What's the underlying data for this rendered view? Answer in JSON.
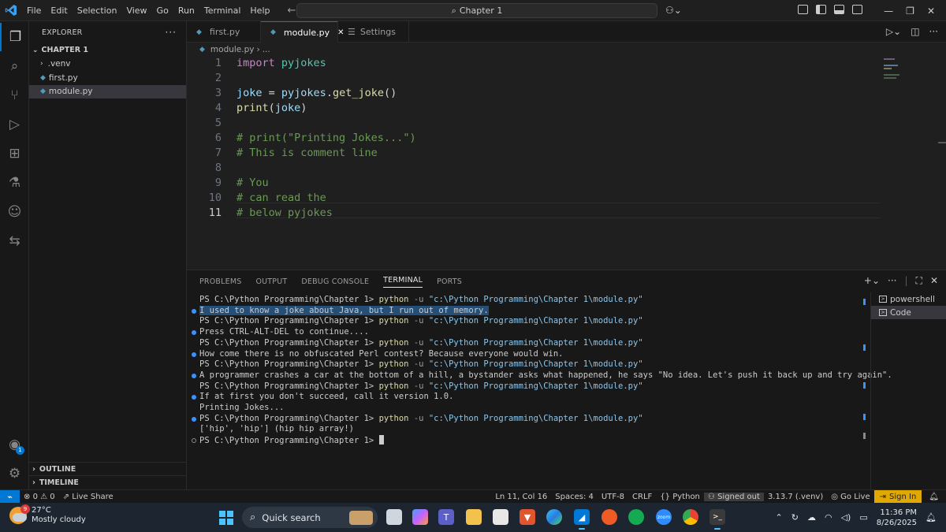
{
  "titlebar": {
    "menu": [
      "File",
      "Edit",
      "Selection",
      "View",
      "Go",
      "Run",
      "Terminal",
      "Help"
    ],
    "search": "Chapter 1"
  },
  "sidebar": {
    "title": "EXPLORER",
    "folder": "CHAPTER 1",
    "items": [
      {
        "label": ".venv"
      },
      {
        "label": "first.py"
      },
      {
        "label": "module.py"
      }
    ],
    "outline": "OUTLINE",
    "timeline": "TIMELINE"
  },
  "tabs": [
    {
      "label": "first.py"
    },
    {
      "label": "module.py"
    },
    {
      "label": "Settings"
    }
  ],
  "breadcrumb": {
    "file": "module.py",
    "rest": "..."
  },
  "editor": {
    "lines": [
      "1",
      "2",
      "3",
      "4",
      "5",
      "6",
      "7",
      "8",
      "9",
      "10",
      "11"
    ],
    "code": {
      "l1_kw": "import",
      "l1_mod": " pyjokes",
      "l3_a": "joke",
      "l3_b": " = ",
      "l3_c": "pyjokes",
      "l3_d": ".",
      "l3_e": "get_joke",
      "l3_f": "()",
      "l4_a": "print",
      "l4_b": "(",
      "l4_c": "joke",
      "l4_d": ")",
      "l6": "# print(\"Printing Jokes...\")",
      "l7": "# This is comment line",
      "l9": "# You",
      "l10": "# can read the",
      "l11": "# below pyjokes"
    }
  },
  "panel": {
    "tabs": [
      "PROBLEMS",
      "OUTPUT",
      "DEBUG CONSOLE",
      "TERMINAL",
      "PORTS"
    ],
    "prompt": "PS C:\\Python Programming\\Chapter 1> ",
    "cmd": "python",
    "flag": " -u ",
    "path": "\"c:\\Python Programming\\Chapter 1\\module.py\"",
    "outputs": [
      "I used to know a joke about Java, but I run out of memory.",
      "Press CTRL-ALT-DEL to continue....",
      "How come there is no obfuscated Perl contest? Because everyone would win.",
      "A programmer crashes a car at the bottom of a hill, a bystander asks what happened, he says \"No idea. Let's push it back up and try again\".",
      "If at first you don't succeed, call it version 1.0.",
      "Printing Jokes...",
      "['hip', 'hip'] (hip hip array!)"
    ],
    "terminals": [
      "powershell",
      "Code"
    ]
  },
  "statusbar": {
    "errors": "0",
    "warnings": "0",
    "liveshare": "Live Share",
    "position": "Ln 11, Col 16",
    "spaces": "Spaces: 4",
    "encoding": "UTF-8",
    "eol": "CRLF",
    "language": "Python",
    "signedout": "Signed out",
    "interpreter": "3.13.7 (.venv)",
    "golive": "Go Live",
    "signin": "Sign In"
  },
  "taskbar": {
    "temp": "27°C",
    "weather": "Mostly cloudy",
    "badge": "9",
    "search": "Quick search",
    "time": "11:36 PM",
    "date": "8/26/2025"
  },
  "colors": {
    "accent": "#0078d4",
    "signin": "#e0a800"
  }
}
